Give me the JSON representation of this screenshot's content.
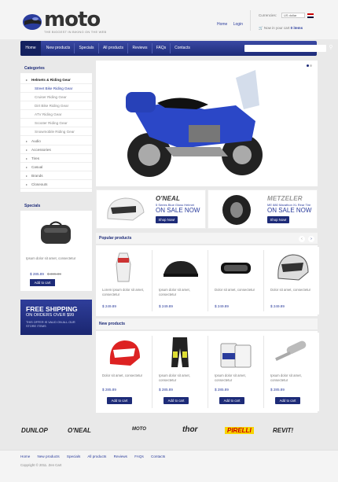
{
  "header": {
    "logo_text": "moto",
    "tagline": "THE BIGGEST IN BIKING ON THE WEB",
    "links": [
      "Home",
      "Login"
    ],
    "currency_label": "Currencies:",
    "currency_value": "US dollar",
    "cart_text": "Now in your cart",
    "cart_count": "0 items"
  },
  "nav": {
    "items": [
      "Home",
      "New products",
      "Specials",
      "All products",
      "Reviews",
      "FAQs",
      "Contacts"
    ]
  },
  "categories": {
    "title": "Categories",
    "items": [
      {
        "label": "Helmets & Riding Gear",
        "level": 0,
        "active": true
      },
      {
        "label": "Street Bike Riding Gear",
        "level": 1
      },
      {
        "label": "Cruiser Riding Gear",
        "level": 1
      },
      {
        "label": "Dirt Bike Riding Gear",
        "level": 1
      },
      {
        "label": "ATV Riding Gear",
        "level": 1
      },
      {
        "label": "Scooter Riding Gear",
        "level": 1
      },
      {
        "label": "Snowmobile Riding Gear",
        "level": 1
      },
      {
        "label": "Audio",
        "level": 0
      },
      {
        "label": "Accessories",
        "level": 0
      },
      {
        "label": "Tires",
        "level": 0
      },
      {
        "label": "Casual",
        "level": 0
      },
      {
        "label": "Brands",
        "level": 0
      },
      {
        "label": "Closeouts",
        "level": 0
      }
    ]
  },
  "specials": {
    "title": "Specials",
    "desc": "Ipsum dolor sit amet, consectetur",
    "price": "$ 285.89",
    "old_price": "$ 385.89",
    "button": "Add to cart"
  },
  "free_shipping": {
    "line1": "FREE SHIPPING",
    "line2": "ON ORDERS OVER $99",
    "note": "THIS OFFER IS VALID ON ALL OUR STORE ITEMS"
  },
  "banners": [
    {
      "brand": "O'NEAL",
      "text": "5 Series Blue Gloss Helmet",
      "sale": "ON SALE NOW",
      "button": "Shop Now!"
    },
    {
      "brand": "METZELER",
      "text": "ME 880 Marathon XL Rear Tire",
      "sale": "ON SALE NOW",
      "button": "Shop Now!"
    }
  ],
  "popular": {
    "title": "Popular products",
    "products": [
      {
        "icon": "gloves-icon",
        "desc": "Lorem ipsum dolor sit amet, consectetur",
        "price": "$ 249.89"
      },
      {
        "icon": "bike-cover-icon",
        "desc": "Ipsum dolor sit amet, consectetur",
        "price": "$ 249.89"
      },
      {
        "icon": "goggles-icon",
        "desc": "Dolor sit amet, consectetur",
        "price": "$ 249.89"
      },
      {
        "icon": "helmet-icon",
        "desc": "Dolor sit amet, consectetur",
        "price": "$ 249.89"
      }
    ]
  },
  "new_products": {
    "title": "New products",
    "button": "Add to cart",
    "products": [
      {
        "icon": "helmet-icon",
        "desc": "Dolor sit amet, consectetur",
        "price": "$ 285.89"
      },
      {
        "icon": "pants-icon",
        "desc": "Ipsum dolor sit amet, consectetur",
        "price": "$ 285.89"
      },
      {
        "icon": "oil-icon",
        "desc": "Ipsum dolor sit amet, consectetur",
        "price": "$ 285.89"
      },
      {
        "icon": "exhaust-icon",
        "desc": "Ipsum dolor sit amet, consectetur",
        "price": "$ 285.89"
      }
    ]
  },
  "brands": [
    "DUNLOP",
    "O'NEAL",
    "MOTO",
    "thor",
    "PIRELLI",
    "REVIT!"
  ],
  "footer": {
    "links": [
      "Home",
      "New products",
      "Specials",
      "All products",
      "Reviews",
      "FAQs",
      "Contacts"
    ],
    "copyright": "Copyright © 2011. Zen Cart"
  },
  "colors": {
    "accent": "#1d2b78",
    "link": "#2a3c9c"
  }
}
